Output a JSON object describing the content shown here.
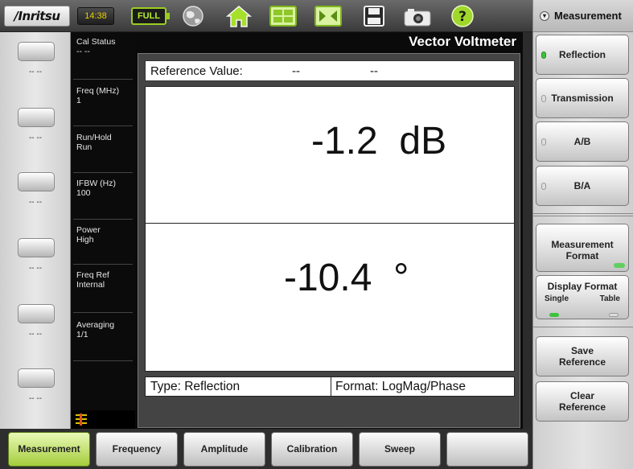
{
  "header": {
    "logo": "/Inritsu",
    "clock": "14:38",
    "battery": "FULL",
    "icons": [
      "globe-icon",
      "home-icon",
      "layout-icon",
      "resize-icon",
      "save-icon",
      "camera-icon",
      "help-icon"
    ]
  },
  "left_softkeys": [
    "-- --",
    "-- --",
    "-- --",
    "-- --",
    "-- --",
    "-- --"
  ],
  "status": [
    {
      "label": "Cal Status",
      "value": "-- --"
    },
    {
      "label": "Freq (MHz)",
      "value": "1"
    },
    {
      "label": "Run/Hold",
      "value": "Run"
    },
    {
      "label": "IFBW (Hz)",
      "value": "100"
    },
    {
      "label": "Power",
      "value": "High"
    },
    {
      "label": "Freq Ref",
      "value": "Internal"
    },
    {
      "label": "Averaging",
      "value": "1/1"
    }
  ],
  "display": {
    "title": "Vector Voltmeter",
    "reference_label": "Reference Value:",
    "reference_val1": "--",
    "reference_val2": "--",
    "magnitude": "-1.2  dB",
    "phase": "-10.4  °",
    "type": "Type: Reflection",
    "format": "Format: LogMag/Phase"
  },
  "menu": {
    "title": "Measurement",
    "buttons": {
      "reflection": "Reflection",
      "transmission": "Transmission",
      "ab": "A/B",
      "ba": "B/A",
      "measurement_format_1": "Measurement",
      "measurement_format_2": "Format",
      "display_format": "Display Format",
      "display_single": "Single",
      "display_table": "Table",
      "save_1": "Save",
      "save_2": "Reference",
      "clear_1": "Clear",
      "clear_2": "Reference"
    },
    "selected": "Reflection"
  },
  "tabs": [
    "Measurement",
    "Frequency",
    "Amplitude",
    "Calibration",
    "Sweep",
    ""
  ],
  "active_tab": "Measurement",
  "colors": {
    "active_tab": "#a4cd3c",
    "led_on": "#3cc23c",
    "clock": "#e8d000"
  }
}
